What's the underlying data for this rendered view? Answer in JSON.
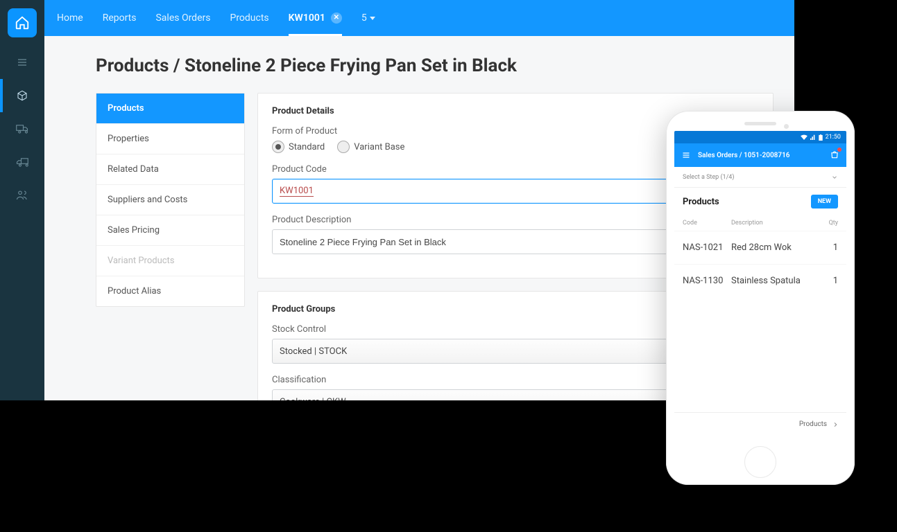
{
  "nav": {
    "items": [
      "Home",
      "Reports",
      "Sales Orders",
      "Products"
    ],
    "active_tab": "KW1001",
    "overflow_count": "5"
  },
  "page": {
    "title": "Products / Stoneline 2 Piece Frying Pan Set in Black"
  },
  "vtabs": [
    {
      "label": "Products",
      "state": "active"
    },
    {
      "label": "Properties",
      "state": ""
    },
    {
      "label": "Related Data",
      "state": ""
    },
    {
      "label": "Suppliers and Costs",
      "state": ""
    },
    {
      "label": "Sales Pricing",
      "state": ""
    },
    {
      "label": "Variant Products",
      "state": "disabled"
    },
    {
      "label": "Product Alias",
      "state": ""
    }
  ],
  "details": {
    "heading": "Product Details",
    "form_of_product_label": "Form of Product",
    "radio_standard": "Standard",
    "radio_variant": "Variant Base",
    "code_label": "Product Code",
    "code_value": "KW1001",
    "desc_label": "Product Description",
    "desc_value": "Stoneline 2 Piece Frying Pan Set in Black"
  },
  "groups": {
    "heading": "Product Groups",
    "stock_label": "Stock Control",
    "stock_value": "Stocked | STOCK",
    "class_label": "Classification",
    "class_value": "Cookware | CKW"
  },
  "mobile": {
    "time": "21:50",
    "breadcrumb": "Sales Orders / 1051-2008716",
    "step": "Select a Step (1/4)",
    "section_title": "Products",
    "new_btn": "NEW",
    "thead": {
      "code": "Code",
      "desc": "Description",
      "qty": "Qty"
    },
    "rows": [
      {
        "code": "NAS-1021",
        "desc": "Red 28cm Wok",
        "qty": "1"
      },
      {
        "code": "NAS-1130",
        "desc": "Stainless Spatula",
        "qty": "1"
      }
    ],
    "footer": "Products"
  }
}
